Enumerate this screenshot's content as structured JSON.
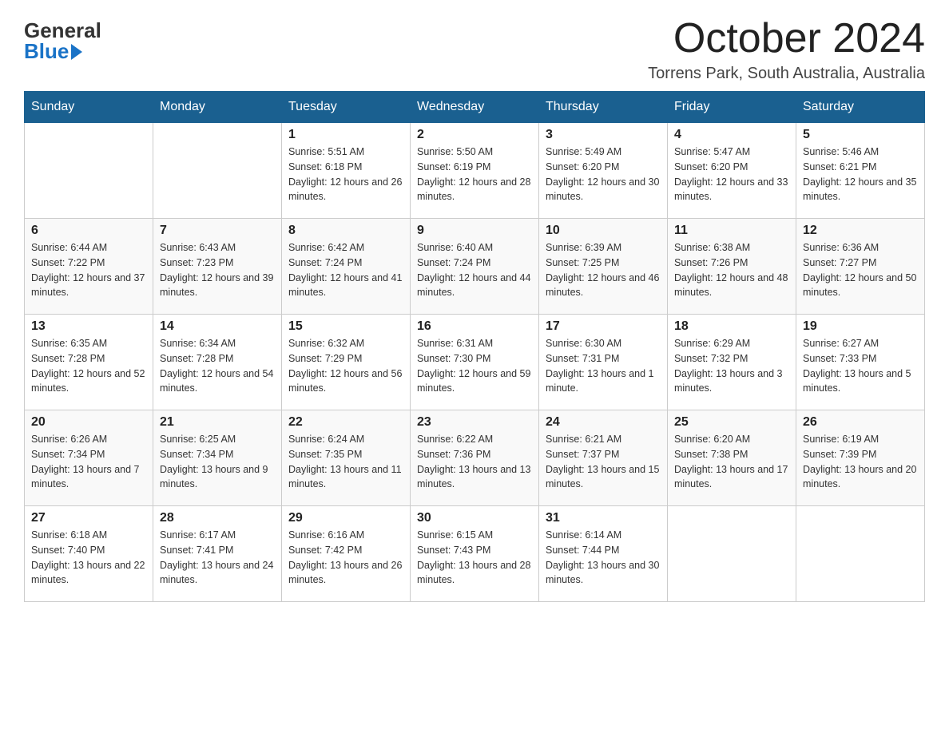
{
  "header": {
    "logo_general": "General",
    "logo_blue": "Blue",
    "month_title": "October 2024",
    "location": "Torrens Park, South Australia, Australia"
  },
  "days_of_week": [
    "Sunday",
    "Monday",
    "Tuesday",
    "Wednesday",
    "Thursday",
    "Friday",
    "Saturday"
  ],
  "weeks": [
    [
      {
        "day": "",
        "sunrise": "",
        "sunset": "",
        "daylight": ""
      },
      {
        "day": "",
        "sunrise": "",
        "sunset": "",
        "daylight": ""
      },
      {
        "day": "1",
        "sunrise": "Sunrise: 5:51 AM",
        "sunset": "Sunset: 6:18 PM",
        "daylight": "Daylight: 12 hours and 26 minutes."
      },
      {
        "day": "2",
        "sunrise": "Sunrise: 5:50 AM",
        "sunset": "Sunset: 6:19 PM",
        "daylight": "Daylight: 12 hours and 28 minutes."
      },
      {
        "day": "3",
        "sunrise": "Sunrise: 5:49 AM",
        "sunset": "Sunset: 6:20 PM",
        "daylight": "Daylight: 12 hours and 30 minutes."
      },
      {
        "day": "4",
        "sunrise": "Sunrise: 5:47 AM",
        "sunset": "Sunset: 6:20 PM",
        "daylight": "Daylight: 12 hours and 33 minutes."
      },
      {
        "day": "5",
        "sunrise": "Sunrise: 5:46 AM",
        "sunset": "Sunset: 6:21 PM",
        "daylight": "Daylight: 12 hours and 35 minutes."
      }
    ],
    [
      {
        "day": "6",
        "sunrise": "Sunrise: 6:44 AM",
        "sunset": "Sunset: 7:22 PM",
        "daylight": "Daylight: 12 hours and 37 minutes."
      },
      {
        "day": "7",
        "sunrise": "Sunrise: 6:43 AM",
        "sunset": "Sunset: 7:23 PM",
        "daylight": "Daylight: 12 hours and 39 minutes."
      },
      {
        "day": "8",
        "sunrise": "Sunrise: 6:42 AM",
        "sunset": "Sunset: 7:24 PM",
        "daylight": "Daylight: 12 hours and 41 minutes."
      },
      {
        "day": "9",
        "sunrise": "Sunrise: 6:40 AM",
        "sunset": "Sunset: 7:24 PM",
        "daylight": "Daylight: 12 hours and 44 minutes."
      },
      {
        "day": "10",
        "sunrise": "Sunrise: 6:39 AM",
        "sunset": "Sunset: 7:25 PM",
        "daylight": "Daylight: 12 hours and 46 minutes."
      },
      {
        "day": "11",
        "sunrise": "Sunrise: 6:38 AM",
        "sunset": "Sunset: 7:26 PM",
        "daylight": "Daylight: 12 hours and 48 minutes."
      },
      {
        "day": "12",
        "sunrise": "Sunrise: 6:36 AM",
        "sunset": "Sunset: 7:27 PM",
        "daylight": "Daylight: 12 hours and 50 minutes."
      }
    ],
    [
      {
        "day": "13",
        "sunrise": "Sunrise: 6:35 AM",
        "sunset": "Sunset: 7:28 PM",
        "daylight": "Daylight: 12 hours and 52 minutes."
      },
      {
        "day": "14",
        "sunrise": "Sunrise: 6:34 AM",
        "sunset": "Sunset: 7:28 PM",
        "daylight": "Daylight: 12 hours and 54 minutes."
      },
      {
        "day": "15",
        "sunrise": "Sunrise: 6:32 AM",
        "sunset": "Sunset: 7:29 PM",
        "daylight": "Daylight: 12 hours and 56 minutes."
      },
      {
        "day": "16",
        "sunrise": "Sunrise: 6:31 AM",
        "sunset": "Sunset: 7:30 PM",
        "daylight": "Daylight: 12 hours and 59 minutes."
      },
      {
        "day": "17",
        "sunrise": "Sunrise: 6:30 AM",
        "sunset": "Sunset: 7:31 PM",
        "daylight": "Daylight: 13 hours and 1 minute."
      },
      {
        "day": "18",
        "sunrise": "Sunrise: 6:29 AM",
        "sunset": "Sunset: 7:32 PM",
        "daylight": "Daylight: 13 hours and 3 minutes."
      },
      {
        "day": "19",
        "sunrise": "Sunrise: 6:27 AM",
        "sunset": "Sunset: 7:33 PM",
        "daylight": "Daylight: 13 hours and 5 minutes."
      }
    ],
    [
      {
        "day": "20",
        "sunrise": "Sunrise: 6:26 AM",
        "sunset": "Sunset: 7:34 PM",
        "daylight": "Daylight: 13 hours and 7 minutes."
      },
      {
        "day": "21",
        "sunrise": "Sunrise: 6:25 AM",
        "sunset": "Sunset: 7:34 PM",
        "daylight": "Daylight: 13 hours and 9 minutes."
      },
      {
        "day": "22",
        "sunrise": "Sunrise: 6:24 AM",
        "sunset": "Sunset: 7:35 PM",
        "daylight": "Daylight: 13 hours and 11 minutes."
      },
      {
        "day": "23",
        "sunrise": "Sunrise: 6:22 AM",
        "sunset": "Sunset: 7:36 PM",
        "daylight": "Daylight: 13 hours and 13 minutes."
      },
      {
        "day": "24",
        "sunrise": "Sunrise: 6:21 AM",
        "sunset": "Sunset: 7:37 PM",
        "daylight": "Daylight: 13 hours and 15 minutes."
      },
      {
        "day": "25",
        "sunrise": "Sunrise: 6:20 AM",
        "sunset": "Sunset: 7:38 PM",
        "daylight": "Daylight: 13 hours and 17 minutes."
      },
      {
        "day": "26",
        "sunrise": "Sunrise: 6:19 AM",
        "sunset": "Sunset: 7:39 PM",
        "daylight": "Daylight: 13 hours and 20 minutes."
      }
    ],
    [
      {
        "day": "27",
        "sunrise": "Sunrise: 6:18 AM",
        "sunset": "Sunset: 7:40 PM",
        "daylight": "Daylight: 13 hours and 22 minutes."
      },
      {
        "day": "28",
        "sunrise": "Sunrise: 6:17 AM",
        "sunset": "Sunset: 7:41 PM",
        "daylight": "Daylight: 13 hours and 24 minutes."
      },
      {
        "day": "29",
        "sunrise": "Sunrise: 6:16 AM",
        "sunset": "Sunset: 7:42 PM",
        "daylight": "Daylight: 13 hours and 26 minutes."
      },
      {
        "day": "30",
        "sunrise": "Sunrise: 6:15 AM",
        "sunset": "Sunset: 7:43 PM",
        "daylight": "Daylight: 13 hours and 28 minutes."
      },
      {
        "day": "31",
        "sunrise": "Sunrise: 6:14 AM",
        "sunset": "Sunset: 7:44 PM",
        "daylight": "Daylight: 13 hours and 30 minutes."
      },
      {
        "day": "",
        "sunrise": "",
        "sunset": "",
        "daylight": ""
      },
      {
        "day": "",
        "sunrise": "",
        "sunset": "",
        "daylight": ""
      }
    ]
  ]
}
